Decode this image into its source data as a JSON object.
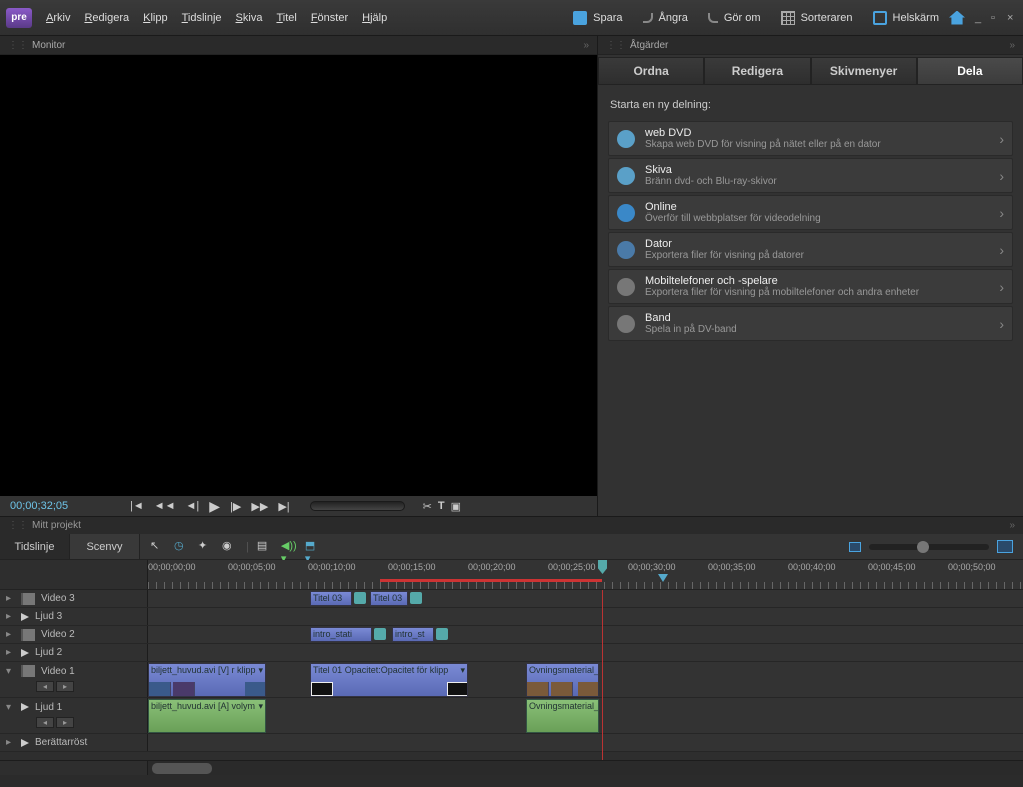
{
  "app": {
    "logo_text": "pre"
  },
  "menus": [
    "Arkiv",
    "Redigera",
    "Klipp",
    "Tidslinje",
    "Skiva",
    "Titel",
    "Fönster",
    "Hjälp"
  ],
  "topbuttons": {
    "save": "Spara",
    "undo": "Ångra",
    "redo": "Gör om",
    "organizer": "Sorteraren",
    "fullscreen": "Helskärm"
  },
  "panels": {
    "monitor": "Monitor",
    "actions": "Åtgärder",
    "project": "Mitt projekt"
  },
  "timecode": "00;00;32;05",
  "action_tabs": [
    "Ordna",
    "Redigera",
    "Skivmenyer",
    "Dela"
  ],
  "active_action_tab": 3,
  "share_header": "Starta en ny delning:",
  "share_items": [
    {
      "title": "web DVD",
      "desc": "Skapa web DVD för visning på nätet eller på en dator",
      "color": "#5aa0c8"
    },
    {
      "title": "Skiva",
      "desc": "Bränn dvd- och Blu-ray-skivor",
      "color": "#5aa0c8"
    },
    {
      "title": "Online",
      "desc": "Överför till webbplatser för videodelning",
      "color": "#3a88c8"
    },
    {
      "title": "Dator",
      "desc": "Exportera filer för visning på datorer",
      "color": "#4a7aa8"
    },
    {
      "title": "Mobiltelefoner och -spelare",
      "desc": "Exportera filer för visning på mobiltelefoner och andra enheter",
      "color": "#777"
    },
    {
      "title": "Band",
      "desc": "Spela in på DV-band",
      "color": "#777"
    }
  ],
  "timeline_tabs": [
    "Tidslinje",
    "Scenvy"
  ],
  "ruler_times": [
    "00;00;00;00",
    "00;00;05;00",
    "00;00;10;00",
    "00;00;15;00",
    "00;00;20;00",
    "00;00;25;00",
    "00;00;30;00",
    "00;00;35;00",
    "00;00;40;00",
    "00;00;45;00",
    "00;00;50;00"
  ],
  "tracks": [
    {
      "name": "Video 3",
      "type": "video",
      "expanded": false
    },
    {
      "name": "Ljud 3",
      "type": "audio",
      "expanded": false
    },
    {
      "name": "Video 2",
      "type": "video",
      "expanded": false
    },
    {
      "name": "Ljud 2",
      "type": "audio",
      "expanded": false
    },
    {
      "name": "Video 1",
      "type": "video",
      "expanded": true
    },
    {
      "name": "Ljud 1",
      "type": "audio",
      "expanded": true
    },
    {
      "name": "Berättarröst",
      "type": "audio",
      "expanded": false
    }
  ],
  "clips": {
    "v3a": "Titel 03",
    "v3b": "Titel 03",
    "v2a": "intro_stati",
    "v2b": "intro_st",
    "v1a": "biljett_huvud.avi [V] r klipp",
    "v1b": "Titel 01",
    "v1b_fx": "Opacitet:Opacitet för klipp",
    "v1c": "Ovningsmaterial_se",
    "a1a": "biljett_huvud.avi [A] volym",
    "a1c": "Ovningsmaterial_se"
  }
}
